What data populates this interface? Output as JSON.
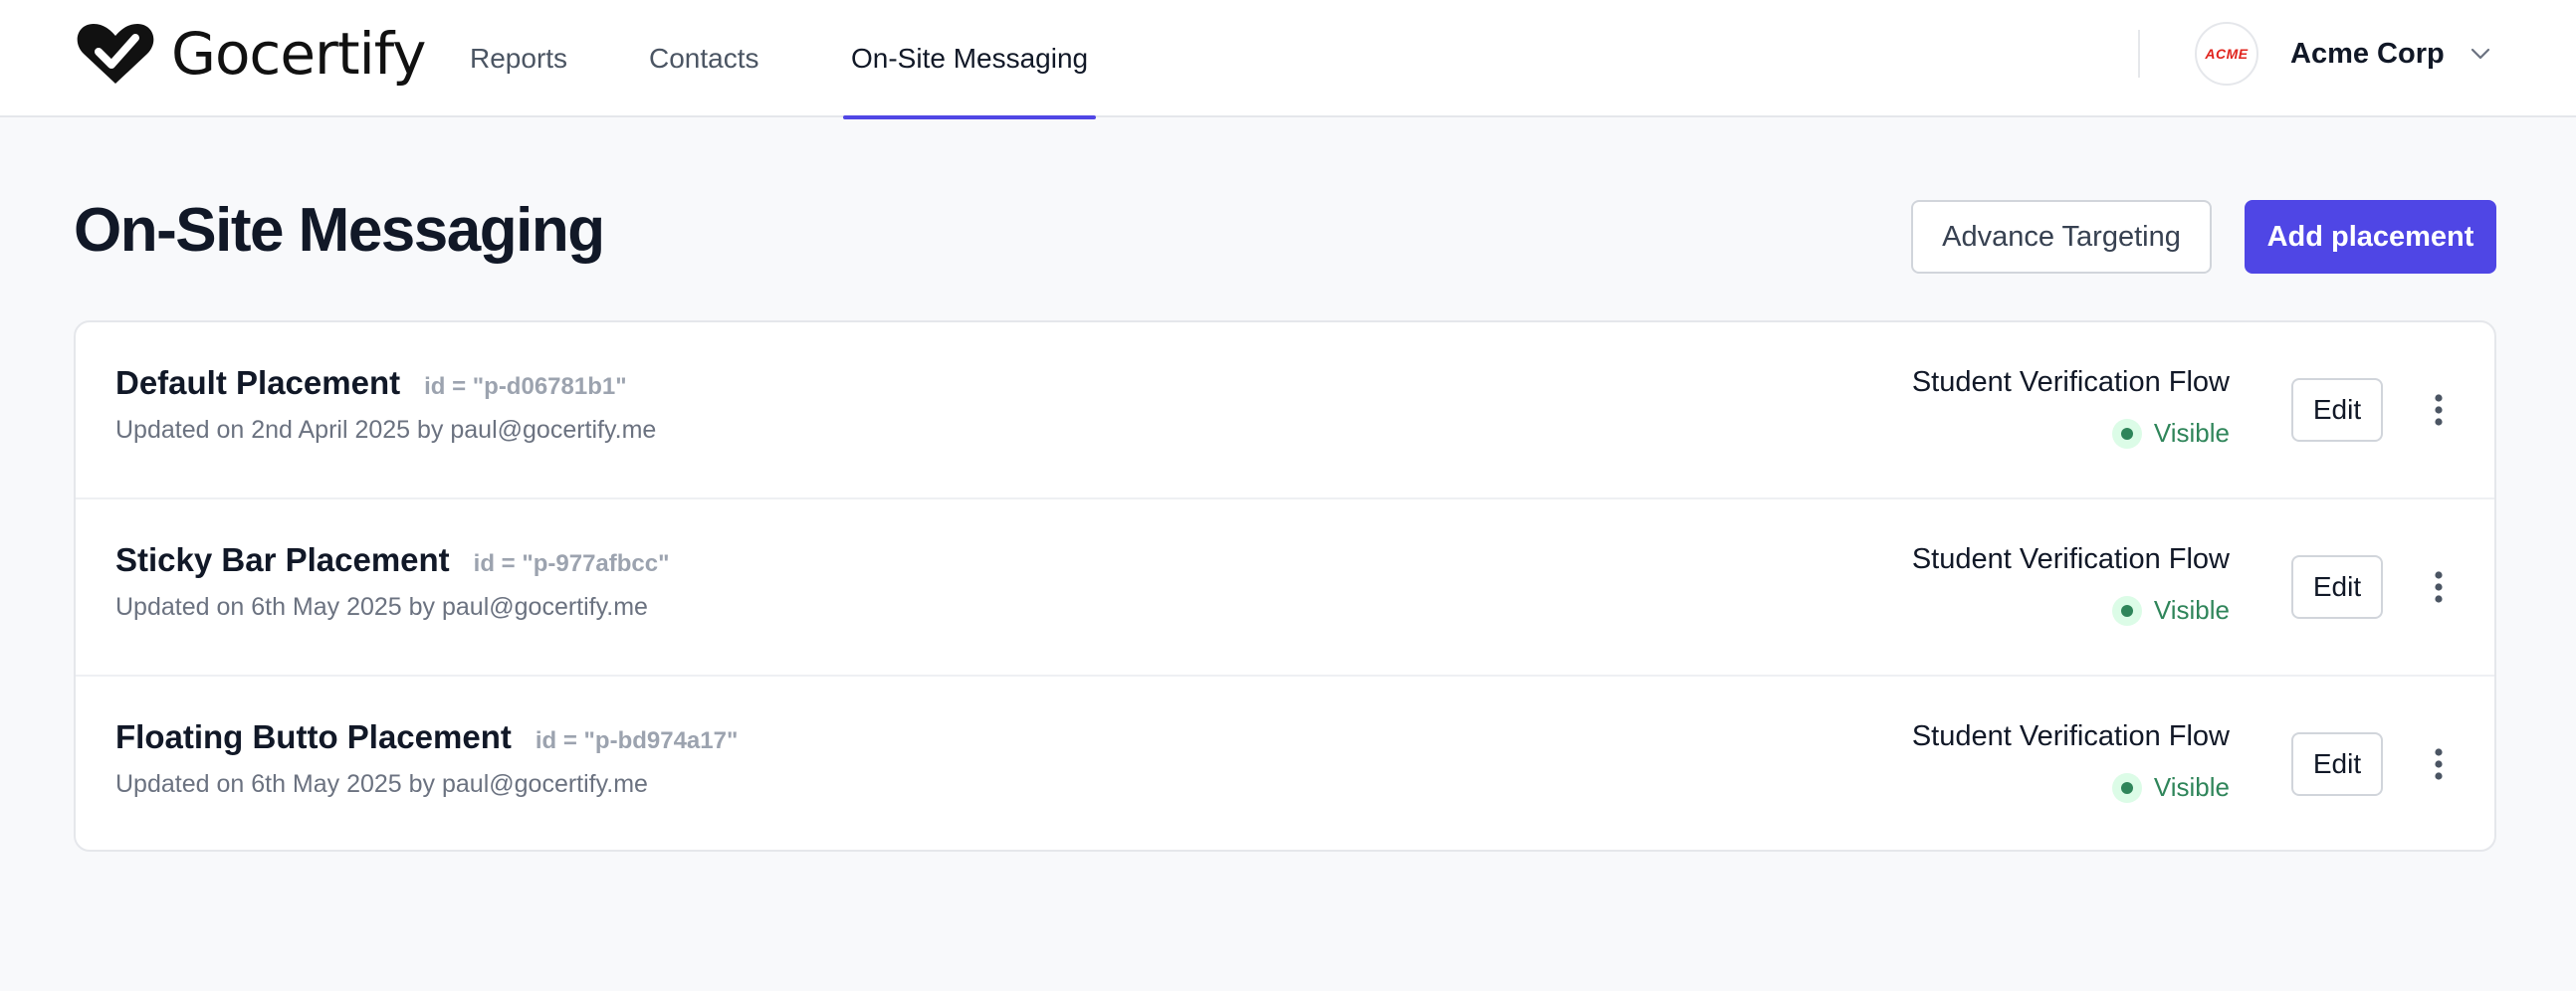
{
  "brand": {
    "name": "Gocertify",
    "icon": "heart-check-logo-icon"
  },
  "nav": {
    "tabs": [
      {
        "label": "Reports",
        "active": false
      },
      {
        "label": "Contacts",
        "active": false
      },
      {
        "label": "On-Site Messaging",
        "active": true
      }
    ]
  },
  "org": {
    "avatar_text": "ACME",
    "name": "Acme Corp",
    "icon": "chevron-down-icon"
  },
  "page": {
    "title": "On-Site Messaging",
    "secondary_button": "Advance Targeting",
    "primary_button": "Add placement"
  },
  "placements": [
    {
      "name": "Default Placement",
      "id_text": "id = \"p-d06781b1\"",
      "meta": "Updated on 2nd April 2025 by paul@gocertify.me",
      "flow": "Student Verification Flow",
      "status": "Visible",
      "edit_label": "Edit"
    },
    {
      "name": "Sticky Bar Placement",
      "id_text": "id = \"p-977afbcc\"",
      "meta": "Updated on 6th May 2025 by paul@gocertify.me",
      "flow": "Student Verification Flow",
      "status": "Visible",
      "edit_label": "Edit"
    },
    {
      "name": "Floating Butto Placement",
      "id_text": "id = \"p-bd974a17\"",
      "meta": "Updated on 6th May 2025 by paul@gocertify.me",
      "flow": "Student Verification Flow",
      "status": "Visible",
      "edit_label": "Edit"
    }
  ],
  "colors": {
    "accent": "#4f46e5",
    "status_visible": "#2f855a",
    "background": "#f8f9fb"
  }
}
